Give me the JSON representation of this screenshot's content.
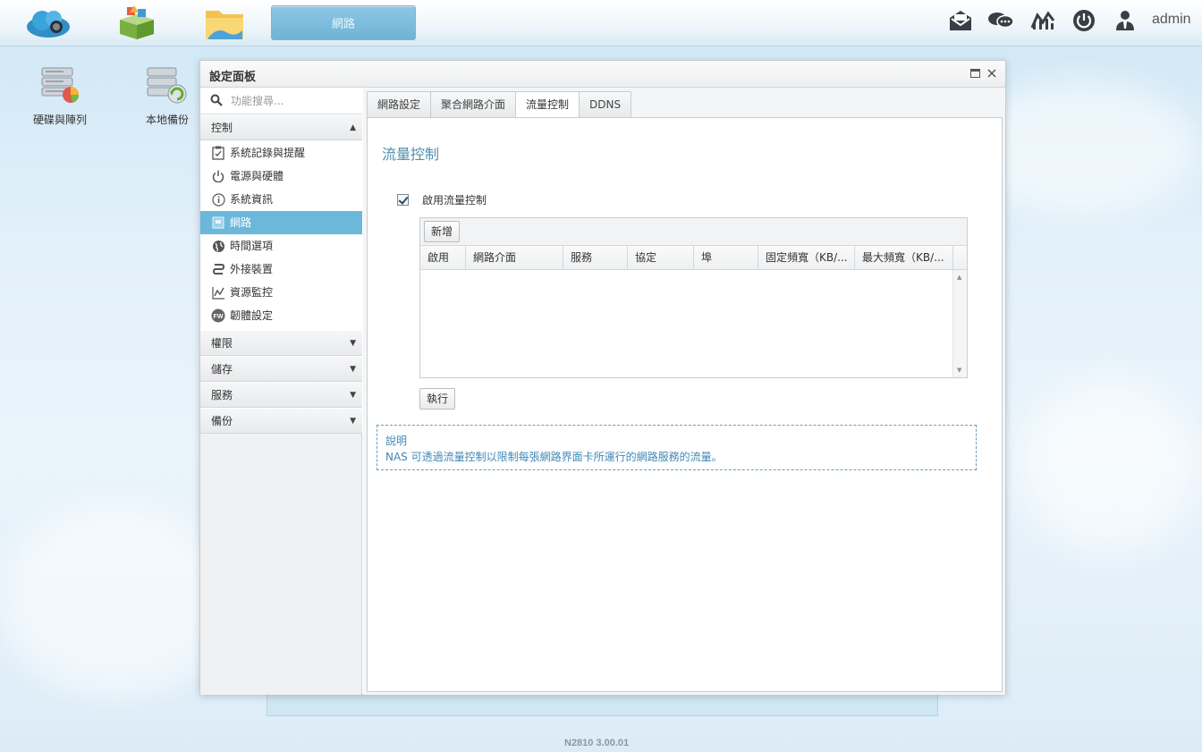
{
  "taskbar": {
    "active_app_label": "網路",
    "user_label": "admin"
  },
  "desktop": {
    "icons": [
      {
        "label": "硬碟與陣列"
      },
      {
        "label": "本地備份"
      }
    ]
  },
  "window": {
    "title": "設定面板"
  },
  "sidebar": {
    "search_placeholder": "功能搜尋...",
    "groups": {
      "control": "控制",
      "permissions": "權限",
      "storage": "儲存",
      "services": "服務",
      "backup": "備份"
    },
    "items": [
      {
        "label": "系統記錄與提醒",
        "icon": "log-icon"
      },
      {
        "label": "電源與硬體",
        "icon": "power-icon"
      },
      {
        "label": "系統資訊",
        "icon": "info-icon"
      },
      {
        "label": "網路",
        "icon": "network-icon",
        "active": true
      },
      {
        "label": "時間選項",
        "icon": "globe-icon"
      },
      {
        "label": "外接裝置",
        "icon": "usb-icon"
      },
      {
        "label": "資源監控",
        "icon": "chart-icon"
      },
      {
        "label": "韌體設定",
        "icon": "firmware-icon"
      }
    ]
  },
  "tabs": [
    "網路設定",
    "聚合網路介面",
    "流量控制",
    "DDNS"
  ],
  "content": {
    "section_title": "流量控制",
    "enable_label": "啟用流量控制",
    "add_button": "新增",
    "columns": [
      "啟用",
      "網路介面",
      "服務",
      "協定",
      "埠",
      "固定頻寬（KB/...",
      "最大頻寬（KB/..."
    ],
    "apply_button": "執行",
    "note_title": "說明",
    "note_text": "NAS 可透過流量控制以限制每張網路界面卡所運行的網路服務的流量。"
  },
  "footer": {
    "version": "N2810   3.00.01"
  },
  "colors": {
    "accent": "#6cb8db",
    "title_blue": "#4e8fb0",
    "note_blue": "#3f88b6"
  }
}
